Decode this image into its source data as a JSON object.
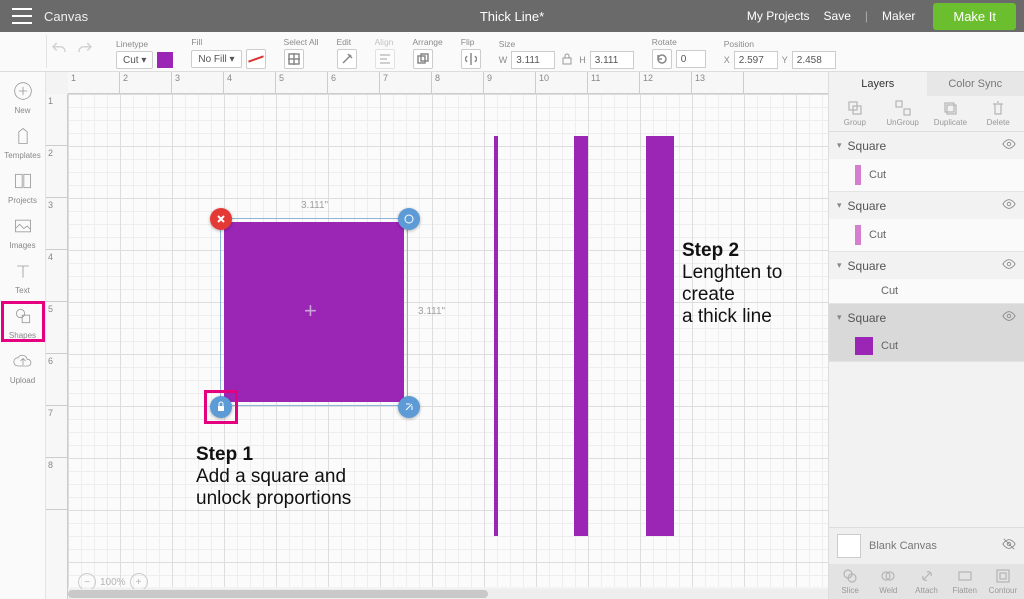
{
  "top": {
    "app_title": "Canvas",
    "doc_title": "Thick Line*",
    "my_projects": "My Projects",
    "save": "Save",
    "machine": "Maker",
    "make_it": "Make It"
  },
  "toolbar": {
    "linetype_label": "Linetype",
    "linetype_value": "Cut",
    "fill_label": "Fill",
    "fill_value": "No Fill",
    "select_all_label": "Select All",
    "edit_label": "Edit",
    "align_label": "Align",
    "arrange_label": "Arrange",
    "flip_label": "Flip",
    "size_label": "Size",
    "size_w": "3.111",
    "size_h": "3.111",
    "rotate_label": "Rotate",
    "rotate_value": "0",
    "position_label": "Position",
    "pos_x": "2.597",
    "pos_y": "2.458"
  },
  "left_tools": {
    "new": "New",
    "templates": "Templates",
    "projects": "Projects",
    "images": "Images",
    "text": "Text",
    "shapes": "Shapes",
    "upload": "Upload"
  },
  "canvas": {
    "sel_w": "3.111\"",
    "sel_h": "3.111\"",
    "zoom": "100%",
    "step1_title": "Step 1",
    "step1_body_a": "Add a square and",
    "step1_body_b": "unlock proportions",
    "step2_title": "Step 2",
    "step2_body_a": "Lenghten to create",
    "step2_body_b": "a thick line",
    "ruler_h": [
      "1",
      "2",
      "3",
      "4",
      "5",
      "6",
      "7",
      "8",
      "9",
      "10",
      "11",
      "12",
      "13"
    ],
    "ruler_v": [
      "1",
      "2",
      "3",
      "4",
      "5",
      "6",
      "7",
      "8"
    ]
  },
  "layers_panel": {
    "tab_layers": "Layers",
    "tab_colorsync": "Color Sync",
    "act_group": "Group",
    "act_ungroup": "UnGroup",
    "act_duplicate": "Duplicate",
    "act_delete": "Delete",
    "items": [
      {
        "name": "Square",
        "sub": "Cut",
        "chip": "thin"
      },
      {
        "name": "Square",
        "sub": "Cut",
        "chip": "thin"
      },
      {
        "name": "Square",
        "sub": "Cut",
        "chip": "none"
      },
      {
        "name": "Square",
        "sub": "Cut",
        "chip": "square",
        "selected": true
      }
    ],
    "blank": "Blank Canvas",
    "bottom": {
      "slice": "Slice",
      "weld": "Weld",
      "attach": "Attach",
      "flatten": "Flatten",
      "contour": "Contour"
    }
  }
}
